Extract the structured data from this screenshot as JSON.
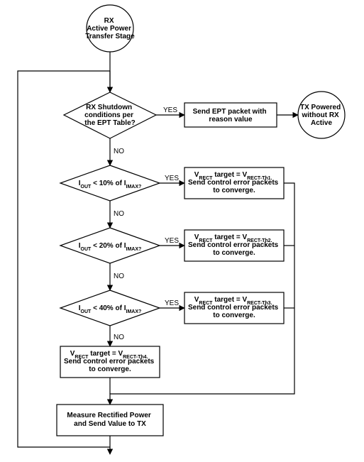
{
  "chart_data": {
    "type": "flowchart",
    "title": "",
    "nodes": [
      {
        "id": "start",
        "shape": "terminator",
        "label_lines": [
          "RX",
          "Active Power",
          "Transfer Stage"
        ]
      },
      {
        "id": "d_ept",
        "shape": "decision",
        "label_lines": [
          "RX Shutdown",
          "conditions per",
          "the EPT Table?"
        ]
      },
      {
        "id": "p_ept",
        "shape": "process",
        "label_lines": [
          "Send EPT packet with",
          "reason value"
        ]
      },
      {
        "id": "end_tx",
        "shape": "terminator",
        "label_lines": [
          "TX Powered",
          "without RX",
          "Active"
        ]
      },
      {
        "id": "d_10",
        "shape": "decision",
        "label_lines": [
          "I_OUT < 10% of I_IMAX?"
        ]
      },
      {
        "id": "p_th1",
        "shape": "process",
        "label_lines": [
          "V_RECT target = V_RECT-Th1.",
          "Send control error packets",
          "to converge."
        ]
      },
      {
        "id": "d_20",
        "shape": "decision",
        "label_lines": [
          "I_OUT < 20% of I_IMAX?"
        ]
      },
      {
        "id": "p_th2",
        "shape": "process",
        "label_lines": [
          "V_RECT target = V_RECT-Th2.",
          "Send control error packets",
          "to converge."
        ]
      },
      {
        "id": "d_40",
        "shape": "decision",
        "label_lines": [
          "I_OUT < 40% of I_IMAX?"
        ]
      },
      {
        "id": "p_th3",
        "shape": "process",
        "label_lines": [
          "V_RECT target = V_RECT-Th3.",
          "Send control error packets",
          "to converge."
        ]
      },
      {
        "id": "p_th4",
        "shape": "process",
        "label_lines": [
          "V_RECT target = V_RECT-Th4.",
          "Send control error packets",
          "to converge."
        ]
      },
      {
        "id": "p_meas",
        "shape": "process",
        "label_lines": [
          "Measure Rectified Power",
          "and Send Value to TX"
        ]
      }
    ],
    "edges": [
      {
        "from": "start",
        "to": "d_ept",
        "label": ""
      },
      {
        "from": "d_ept",
        "to": "p_ept",
        "label": "YES"
      },
      {
        "from": "p_ept",
        "to": "end_tx",
        "label": ""
      },
      {
        "from": "d_ept",
        "to": "d_10",
        "label": "NO"
      },
      {
        "from": "d_10",
        "to": "p_th1",
        "label": "YES"
      },
      {
        "from": "d_10",
        "to": "d_20",
        "label": "NO"
      },
      {
        "from": "d_20",
        "to": "p_th2",
        "label": "YES"
      },
      {
        "from": "d_20",
        "to": "d_40",
        "label": "NO"
      },
      {
        "from": "d_40",
        "to": "p_th3",
        "label": "YES"
      },
      {
        "from": "d_40",
        "to": "p_th4",
        "label": "NO"
      },
      {
        "from": "p_th1",
        "to": "p_meas",
        "label": ""
      },
      {
        "from": "p_th2",
        "to": "p_meas",
        "label": ""
      },
      {
        "from": "p_th3",
        "to": "p_meas",
        "label": ""
      },
      {
        "from": "p_th4",
        "to": "p_meas",
        "label": ""
      },
      {
        "from": "p_meas",
        "to": "d_ept",
        "label": "",
        "note": "loop back"
      }
    ],
    "edge_labels": {
      "yes": "YES",
      "no": "NO"
    }
  }
}
